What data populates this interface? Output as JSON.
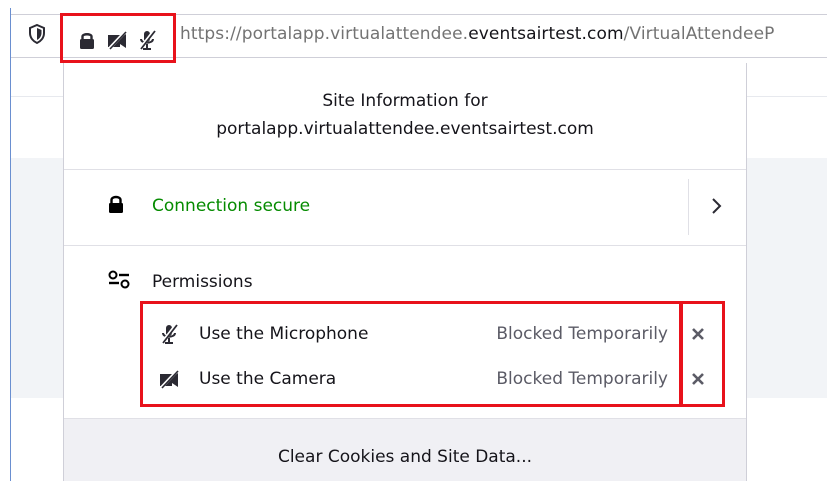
{
  "urlbar": {
    "url_prefix": "https://portalapp.virtualattendee.",
    "url_domain": "eventsairtest.com",
    "url_suffix": "/VirtualAttendeeP"
  },
  "identity_icons": [
    "lock-icon",
    "camera-blocked-icon",
    "microphone-blocked-icon"
  ],
  "panel": {
    "title_line1": "Site Information for",
    "title_line2": "portalapp.virtualattendee.eventsairtest.com",
    "connection": {
      "label": "Connection secure",
      "color": "#058b00"
    },
    "permissions_header": "Permissions",
    "permissions": [
      {
        "label": "Use the Microphone",
        "state": "Blocked Temporarily",
        "icon": "microphone-blocked-icon"
      },
      {
        "label": "Use the Camera",
        "state": "Blocked Temporarily",
        "icon": "camera-blocked-icon"
      }
    ],
    "footer_button": "Clear Cookies and Site Data..."
  },
  "highlight_color": "#e8121b"
}
